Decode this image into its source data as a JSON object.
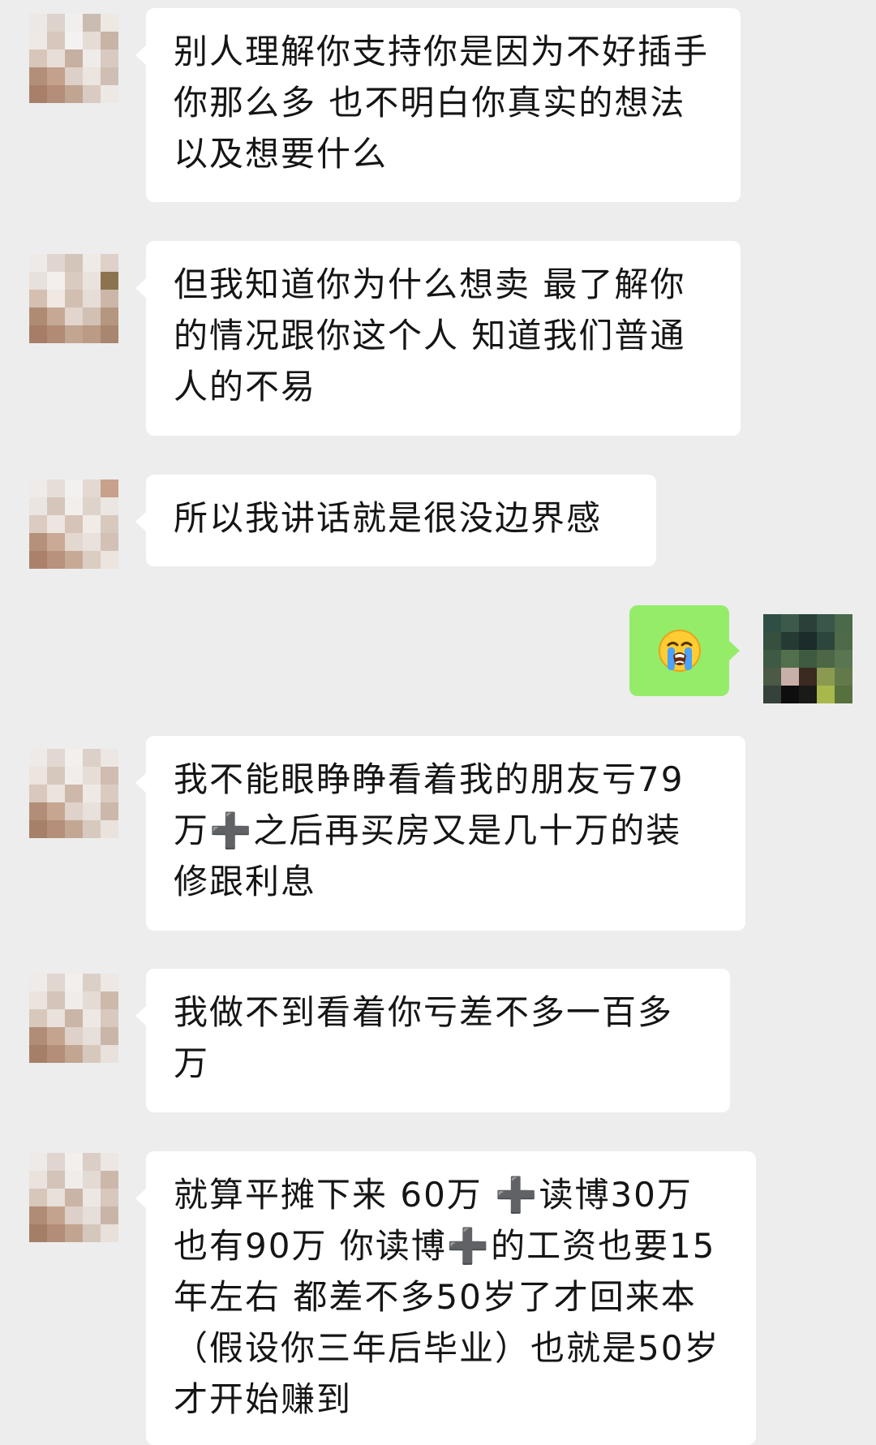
{
  "conversation": {
    "messages": [
      {
        "side": "left",
        "text": "别人理解你支持你是因为不好插手你那么多 也不明白你真实的想法 以及想要什么"
      },
      {
        "side": "left",
        "text": "但我知道你为什么想卖 最了解你的情况跟你这个人 知道我们普通人的不易"
      },
      {
        "side": "left",
        "text": "所以我讲话就是很没边界感"
      },
      {
        "side": "right",
        "emoji": "loudly-crying-face-emoji"
      },
      {
        "side": "left",
        "text": "我不能眼睁睁看着我的朋友亏79万➕之后再买房又是几十万的装修跟利息"
      },
      {
        "side": "left",
        "text": "我做不到看着你亏差不多一百多万"
      },
      {
        "side": "left",
        "text": "就算平摊下来 60万 ➕读博30万 也有90万 你读博➕的工资也要15年左右 都差不多50岁了才回来本（假设你三年后毕业）也就是50岁才开始赚到"
      }
    ]
  },
  "colors": {
    "background": "#ededed",
    "incoming_bubble": "#ffffff",
    "outgoing_bubble": "#95ec69"
  }
}
